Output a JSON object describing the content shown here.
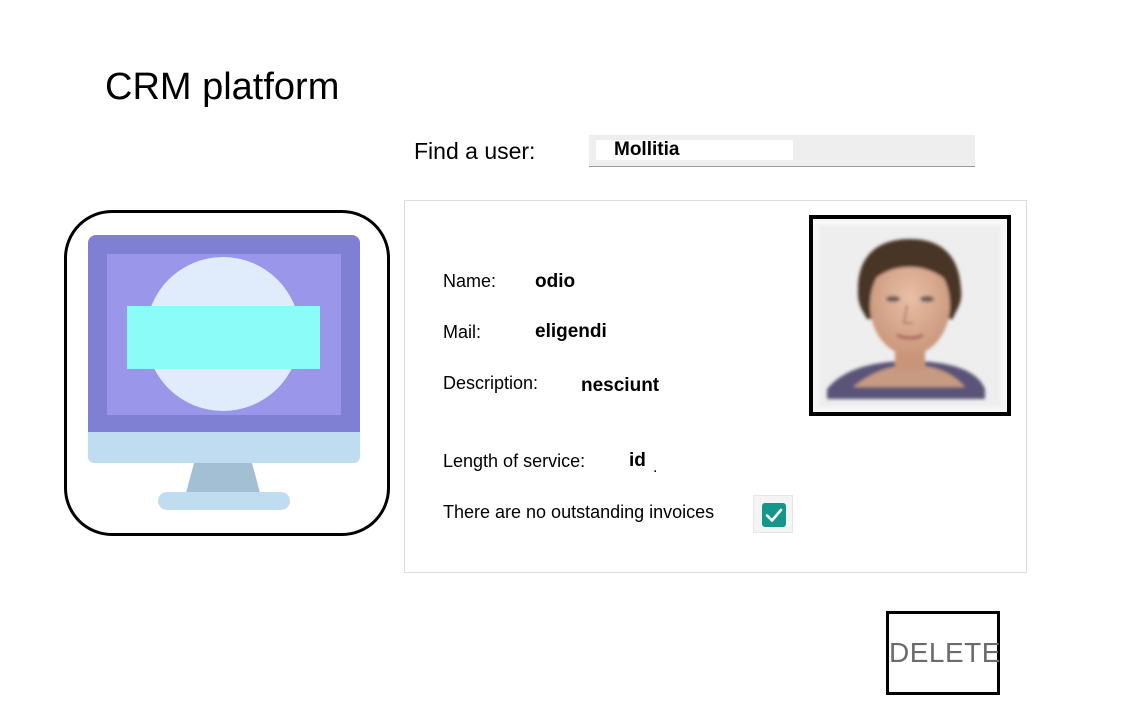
{
  "app": {
    "title": "CRM platform"
  },
  "search": {
    "label": "Find a user:",
    "value": "Mollitia"
  },
  "logo": {
    "icon": "computer-monitor-icon"
  },
  "user": {
    "fields": {
      "name_label": "Name:",
      "name_value": "odio",
      "mail_label": "Mail:",
      "mail_value": "eligendi",
      "description_label": "Description:",
      "description_value": "nesciunt",
      "service_label": "Length of service:",
      "service_value": "id",
      "service_suffix": ".",
      "invoices_label": "There are no outstanding invoices"
    },
    "invoices_checked": true,
    "photo": "user-photo"
  },
  "actions": {
    "delete_label": "DELETE"
  },
  "colors": {
    "checkbox": "#14968a",
    "monitor_frame": "#7f7fd3",
    "monitor_screen": "#9a96ea",
    "monitor_circle": "#e0ecfb",
    "monitor_bar": "#8cfcf8",
    "monitor_stand": "#bfdcf0"
  }
}
